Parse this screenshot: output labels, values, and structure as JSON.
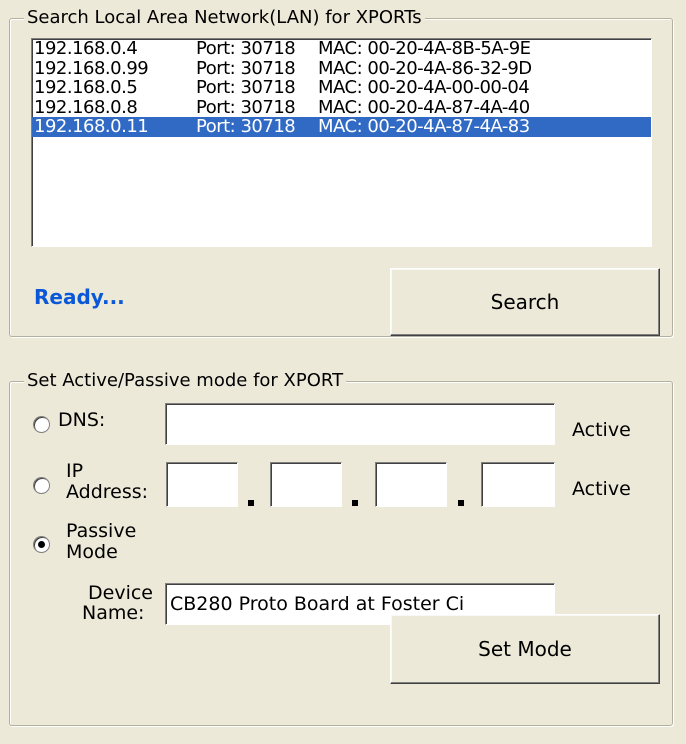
{
  "search_group": {
    "title": "Search Local Area Network(LAN) for XPORTs",
    "devices": [
      {
        "ip": "192.168.0.4",
        "port": "Port: 30718",
        "mac": "MAC: 00-20-4A-8B-5A-9E"
      },
      {
        "ip": "192.168.0.99",
        "port": "Port: 30718",
        "mac": "MAC: 00-20-4A-86-32-9D"
      },
      {
        "ip": "192.168.0.5",
        "port": "Port: 30718",
        "mac": "MAC: 00-20-4A-00-00-04"
      },
      {
        "ip": "192.168.0.8",
        "port": "Port: 30718",
        "mac": "MAC: 00-20-4A-87-4A-40"
      },
      {
        "ip": "192.168.0.11",
        "port": "Port: 30718",
        "mac": "MAC: 00-20-4A-87-4A-83"
      }
    ],
    "selected_index": 4,
    "status": "Ready...",
    "search_label": "Search"
  },
  "mode_group": {
    "title": "Set Active/Passive mode for XPORT",
    "dns_label": "DNS:",
    "dns_value": "",
    "dns_suffix": "Active",
    "ip_label_line1": "IP",
    "ip_label_line2": "Address:",
    "ip_octets": [
      "",
      "",
      "",
      ""
    ],
    "ip_suffix": "Active",
    "passive_label_line1": "Passive",
    "passive_label_line2": "Mode",
    "selected_mode": "passive",
    "device_name_label_line1": "Device",
    "device_name_label_line2": "Name:",
    "device_name_value": "CB280 Proto Board at Foster Ci",
    "set_mode_label": "Set Mode"
  },
  "colors": {
    "background": "#ece9d8",
    "selection": "#316ac5",
    "status_text": "#0a58d8"
  }
}
